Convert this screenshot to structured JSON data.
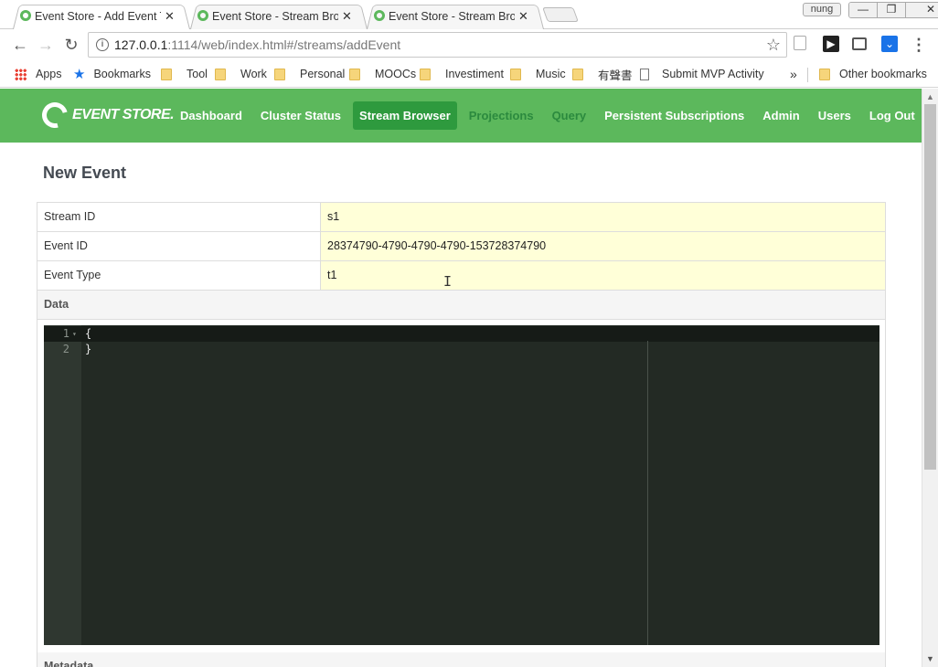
{
  "browser": {
    "tabs": [
      {
        "title": "Event Store - Add Event T",
        "active": true
      },
      {
        "title": "Event Store - Stream Brow",
        "active": false
      },
      {
        "title": "Event Store - Stream Brow",
        "active": false
      }
    ],
    "profile": "nung",
    "window_buttons": [
      "—",
      "❐",
      "✕"
    ],
    "url_host": "127.0.0.1",
    "url_path": ":1114/web/index.html#/streams/addEvent",
    "bookmarks": [
      "Apps",
      "Bookmarks",
      "Tool",
      "Work",
      "Personal",
      "MOOCs",
      "Investiment",
      "Music",
      "有聲書",
      "Submit MVP Activity"
    ],
    "bookmarks_overflow": "»",
    "other_bookmarks": "Other bookmarks"
  },
  "app": {
    "logo_text": "EVENT STORE.",
    "nav": [
      {
        "label": "Dashboard",
        "state": "normal"
      },
      {
        "label": "Cluster Status",
        "state": "normal"
      },
      {
        "label": "Stream Browser",
        "state": "active"
      },
      {
        "label": "Projections",
        "state": "dim"
      },
      {
        "label": "Query",
        "state": "dim"
      },
      {
        "label": "Persistent Subscriptions",
        "state": "normal"
      },
      {
        "label": "Admin",
        "state": "normal"
      },
      {
        "label": "Users",
        "state": "normal"
      },
      {
        "label": "Log Out",
        "state": "normal"
      }
    ],
    "colors": {
      "header": "#5cb85c",
      "active_nav": "#2e9a3e",
      "input_bg": "#ffffd8",
      "editor_bg": "#232a24"
    }
  },
  "form": {
    "title": "New Event",
    "fields": [
      {
        "label": "Stream ID",
        "value": "s1"
      },
      {
        "label": "Event ID",
        "value": "28374790-4790-4790-4790-153728374790"
      },
      {
        "label": "Event Type",
        "value": "t1"
      }
    ],
    "data_label": "Data",
    "editor_lines": [
      {
        "number": "1",
        "code": "{"
      },
      {
        "number": "2",
        "code": "}"
      }
    ],
    "metadata_label": "Metadata"
  }
}
